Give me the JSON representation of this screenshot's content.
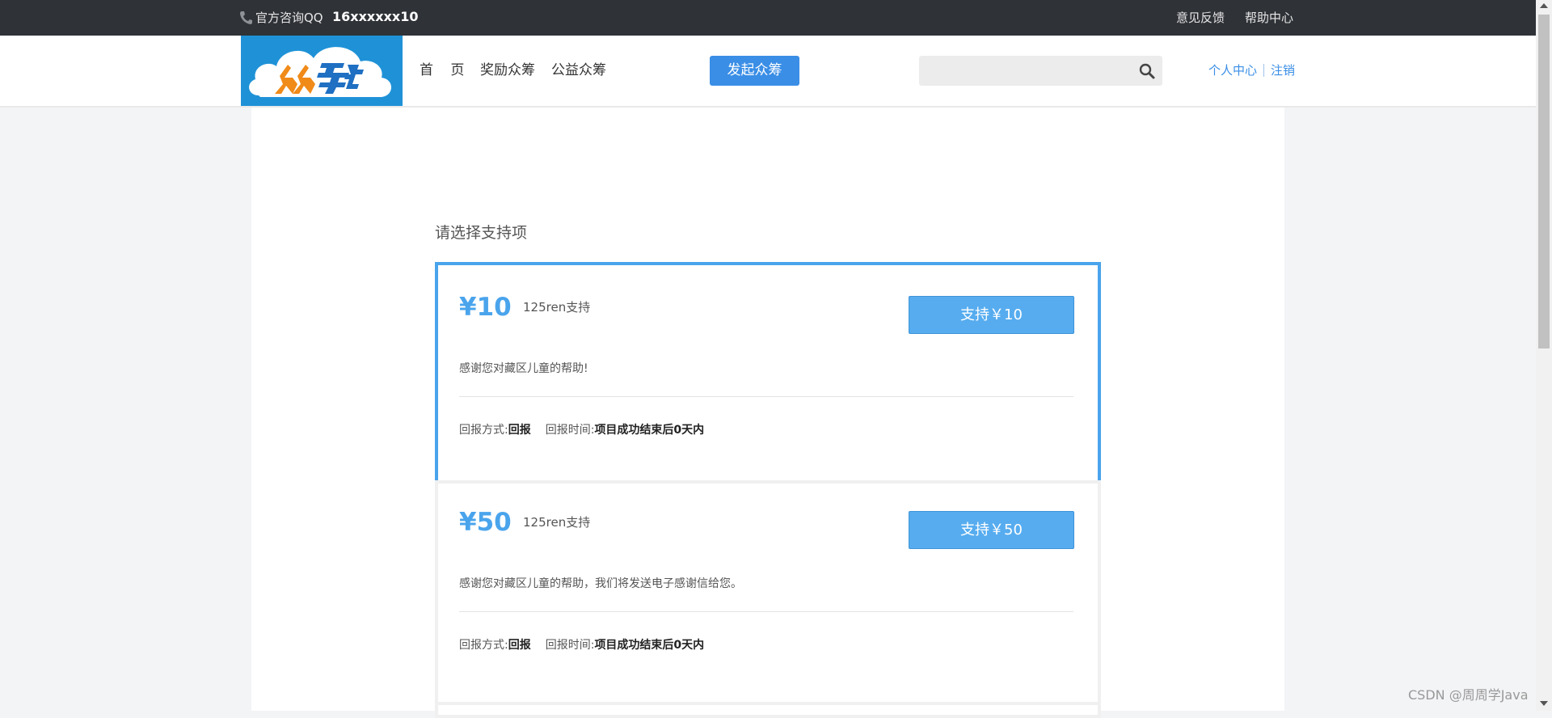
{
  "topbar": {
    "qq_label": "官方咨询QQ",
    "qq_number": "16xxxxxx10",
    "feedback": "意见反馈",
    "help_center": "帮助中心"
  },
  "header": {
    "nav": [
      "首 页",
      "奖励众筹",
      "公益众筹"
    ],
    "launch_button": "发起众筹",
    "search_placeholder": "",
    "user_center": "个人中心",
    "logout": "注销",
    "logo_alt": "众筹"
  },
  "main": {
    "section_title": "请选择支持项",
    "rewards": [
      {
        "price": "¥10",
        "backers": "125ren支持",
        "button": "支持￥10",
        "description": "感谢您对藏区儿童的帮助!",
        "method_label": "回报方式:",
        "method_value": "回报",
        "time_label": "回报时间:",
        "time_value": "项目成功结束后0天内",
        "selected": true
      },
      {
        "price": "¥50",
        "backers": "125ren支持",
        "button": "支持￥50",
        "description": "感谢您对藏区儿童的帮助，我们将发送电子感谢信给您。",
        "method_label": "回报方式:",
        "method_value": "回报",
        "time_label": "回报时间:",
        "time_value": "项目成功结束后0天内",
        "selected": false
      }
    ]
  },
  "watermark": "CSDN @周周学Java",
  "colors": {
    "topbar_bg": "#2f3237",
    "accent": "#4aa4ec",
    "link": "#3a8ee6",
    "logo_bg": "#1f92d7",
    "logo_orange": "#f08a18"
  }
}
